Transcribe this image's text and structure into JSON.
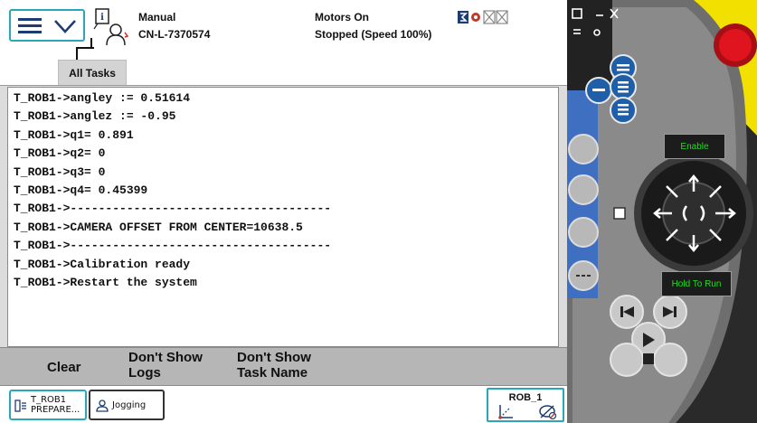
{
  "header": {
    "mode": "Manual",
    "system_name": "CN-L-7370574",
    "motors_state": "Motors On",
    "run_state": "Stopped (Speed 100%)"
  },
  "tabs": {
    "all_tasks": "All Tasks"
  },
  "log": {
    "lines": [
      "T_ROB1->angley := 0.51614",
      "T_ROB1->anglez := -0.95",
      "T_ROB1->q1= 0.891",
      "T_ROB1->q2= 0",
      "T_ROB1->q3= 0",
      "T_ROB1->q4= 0.45399",
      "T_ROB1->-------------------------------------",
      "T_ROB1->CAMERA OFFSET FROM CENTER=10638.5",
      "T_ROB1->-------------------------------------",
      "T_ROB1->Calibration ready",
      "T_ROB1->Restart the system"
    ]
  },
  "actions": {
    "clear": "Clear",
    "dont_show_logs_1": "Don't Show",
    "dont_show_logs_2": "Logs",
    "dont_show_task_1": "Don't Show",
    "dont_show_task_2": "Task Name"
  },
  "taskbar": {
    "rob_line1": "T_ROB1",
    "rob_line2": "PREPARE...",
    "jogging": "Jogging",
    "quickset_label": "ROB_1"
  },
  "hardware": {
    "enable": "Enable",
    "hold_to_run": "Hold To Run"
  },
  "colors": {
    "accent_teal": "#2aa7b5",
    "pendant_yellow": "#f2e000",
    "estop_red": "#e0141e",
    "button_blue": "#1f5ea8",
    "hw_label_green": "#22dd22"
  },
  "icons": {
    "menu": "hamburger-icon",
    "info": "operator-info-icon",
    "status": "status-indicators-icons",
    "jog": "joystick-icon"
  }
}
